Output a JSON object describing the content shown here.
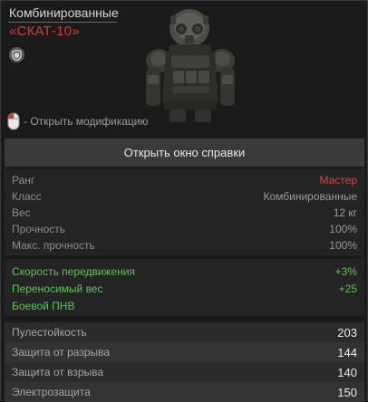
{
  "header": {
    "category": "Комбинированные",
    "item_name": "«СКАТ-10»",
    "hint_text": "- Открыть модификацию"
  },
  "help_button": {
    "label": "Открыть окно справки"
  },
  "info_rows": [
    {
      "label": "Ранг",
      "value": "Мастер"
    },
    {
      "label": "Класс",
      "value": "Комбинированные"
    },
    {
      "label": "Вес",
      "value": "12 кг"
    },
    {
      "label": "Прочность",
      "value": "100%"
    },
    {
      "label": "Макс. прочность",
      "value": "100%"
    }
  ],
  "bonus_rows": [
    {
      "label": "Скорость передвижения",
      "value": "+3%"
    },
    {
      "label": "Переносимый вес",
      "value": "+25"
    },
    {
      "label": "Боевой ПНВ",
      "value": ""
    }
  ],
  "protection_rows": [
    {
      "label": "Пулестойкость",
      "value": "203"
    },
    {
      "label": "Защита от разрыва",
      "value": "144"
    },
    {
      "label": "Защита от взрыва",
      "value": "140"
    },
    {
      "label": "Электрозащита",
      "value": "150"
    }
  ],
  "colors": {
    "item_name": "#d8383a",
    "rank_value": "#d84646",
    "bonus_text": "#5fc25a",
    "background": "#1b1b1b"
  },
  "icons": {
    "badge": "shield-icon",
    "hint": "mouse-icon",
    "item": "armor-suit-icon"
  }
}
